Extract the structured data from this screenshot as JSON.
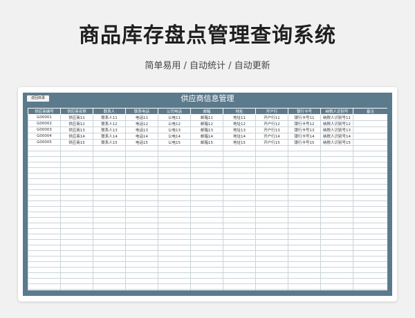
{
  "page": {
    "title": "商品库存盘点管理查询系统",
    "subtitle": "简单易用 / 自动统计 / 自动更新"
  },
  "sheet": {
    "back_label": "返回目录",
    "title": "供应商信息管理",
    "headers": [
      "供应商编号",
      "供应商名称",
      "联系人",
      "联系电话",
      "公司电话",
      "邮箱",
      "地址",
      "开户行",
      "银行卡号",
      "纳税人识别号",
      "备注"
    ],
    "rows": [
      [
        "G00001",
        "供应商11",
        "联系人11",
        "电话11",
        "公电11",
        "邮箱11",
        "地址11",
        "开户行11",
        "银行卡号11",
        "纳税人识别号11",
        ""
      ],
      [
        "G00002",
        "供应商12",
        "联系人12",
        "电话12",
        "公电12",
        "邮箱12",
        "地址12",
        "开户行12",
        "银行卡号12",
        "纳税人识别号12",
        ""
      ],
      [
        "G00003",
        "供应商13",
        "联系人13",
        "电话13",
        "公电13",
        "邮箱13",
        "地址13",
        "开户行13",
        "银行卡号13",
        "纳税人识别号13",
        ""
      ],
      [
        "G00004",
        "供应商14",
        "联系人14",
        "电话14",
        "公电14",
        "邮箱14",
        "地址14",
        "开户行14",
        "银行卡号14",
        "纳税人识别号14",
        ""
      ],
      [
        "G00005",
        "供应商15",
        "联系人15",
        "电话15",
        "公电15",
        "邮箱15",
        "地址15",
        "开户行15",
        "银行卡号15",
        "纳税人识别号15",
        ""
      ]
    ]
  },
  "colors": {
    "header": "#5b7a8c",
    "grid_line": "#c9d3d9"
  }
}
